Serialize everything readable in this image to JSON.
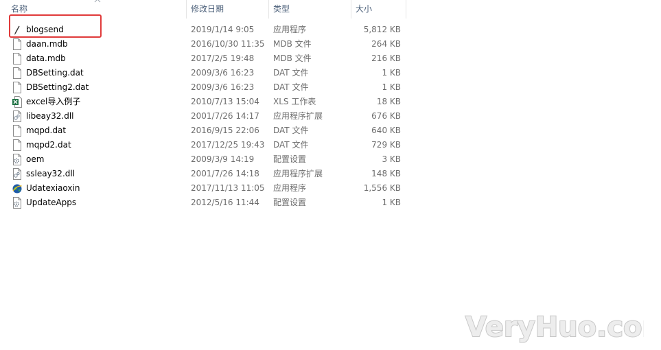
{
  "columns": {
    "name": "名称",
    "date": "修改日期",
    "type": "类型",
    "size": "大小"
  },
  "files": [
    {
      "name": "blogsend",
      "date": "2019/1/14 9:05",
      "type": "应用程序",
      "size": "5,812 KB",
      "icon": "app-pen-icon"
    },
    {
      "name": "daan.mdb",
      "date": "2016/10/30 11:35",
      "type": "MDB 文件",
      "size": "264 KB",
      "icon": "file-icon"
    },
    {
      "name": "data.mdb",
      "date": "2017/2/5 19:48",
      "type": "MDB 文件",
      "size": "216 KB",
      "icon": "file-icon"
    },
    {
      "name": "DBSetting.dat",
      "date": "2009/3/6 16:23",
      "type": "DAT 文件",
      "size": "1 KB",
      "icon": "file-icon"
    },
    {
      "name": "DBSetting2.dat",
      "date": "2009/3/6 16:23",
      "type": "DAT 文件",
      "size": "1 KB",
      "icon": "file-icon"
    },
    {
      "name": "excel导入例子",
      "date": "2010/7/13 15:04",
      "type": "XLS 工作表",
      "size": "18 KB",
      "icon": "excel-file-icon"
    },
    {
      "name": "libeay32.dll",
      "date": "2001/7/26 14:17",
      "type": "应用程序扩展",
      "size": "676 KB",
      "icon": "dll-file-icon"
    },
    {
      "name": "mqpd.dat",
      "date": "2016/9/15 22:06",
      "type": "DAT 文件",
      "size": "640 KB",
      "icon": "file-icon"
    },
    {
      "name": "mqpd2.dat",
      "date": "2017/12/25 19:43",
      "type": "DAT 文件",
      "size": "729 KB",
      "icon": "file-icon"
    },
    {
      "name": "oem",
      "date": "2009/3/9 14:19",
      "type": "配置设置",
      "size": "3 KB",
      "icon": "config-file-icon"
    },
    {
      "name": "ssleay32.dll",
      "date": "2001/7/26 14:18",
      "type": "应用程序扩展",
      "size": "148 KB",
      "icon": "dll-file-icon"
    },
    {
      "name": "Udatexiaoxin",
      "date": "2017/11/13 11:05",
      "type": "应用程序",
      "size": "1,556 KB",
      "icon": "app-globe-icon"
    },
    {
      "name": "UpdateApps",
      "date": "2012/5/16 11:44",
      "type": "配置设置",
      "size": "1 KB",
      "icon": "config-file-icon"
    }
  ],
  "watermark": "VeryHuo.com",
  "colors": {
    "highlight": "#e03a3a",
    "header_text": "#4c607a",
    "secondary_text": "#6d6d6d"
  }
}
